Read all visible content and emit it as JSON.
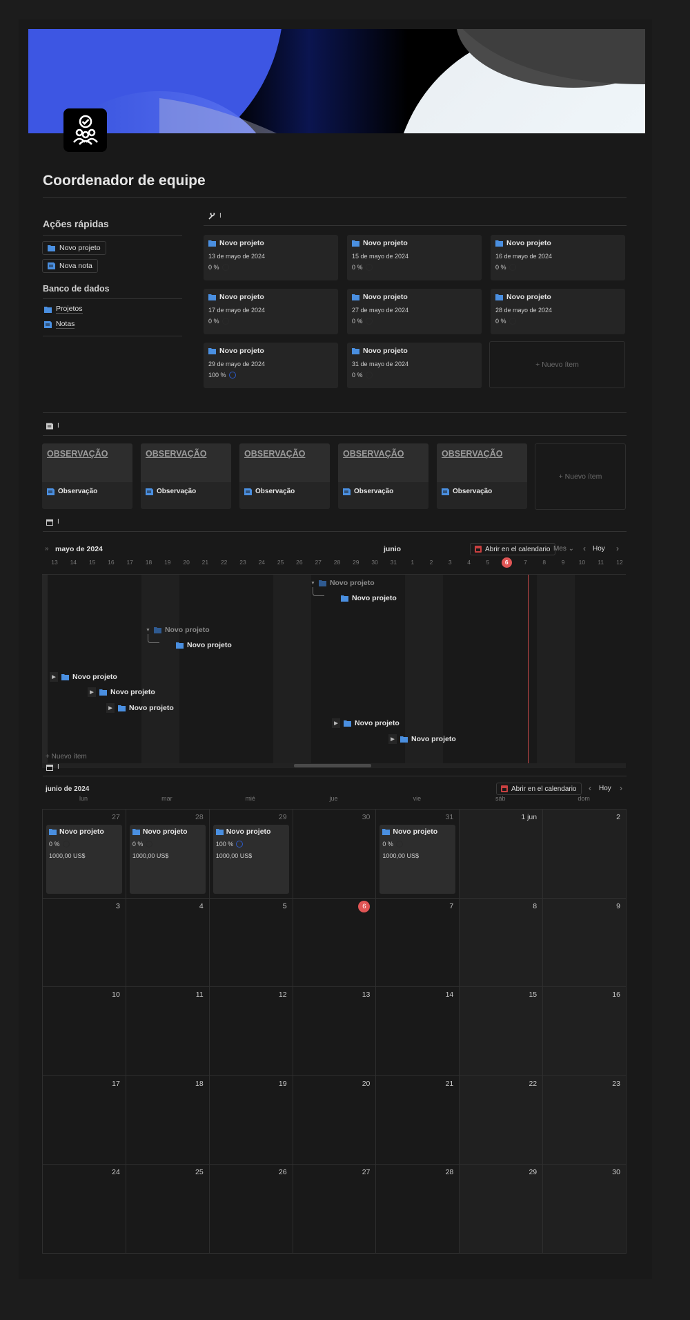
{
  "page": {
    "title": "Coordenador de equipe",
    "colors": {
      "accent_blue": "#3a5ce6",
      "folder_blue": "#4a8fe0",
      "today_red": "#e05555"
    }
  },
  "quick_actions": {
    "heading": "Ações rápidas",
    "buttons": [
      "Novo projeto",
      "Nova nota"
    ]
  },
  "databases": {
    "heading": "Banco de dados",
    "links": [
      "Projetos",
      "Notas"
    ]
  },
  "projects_gallery": {
    "header_label": "I",
    "cards": [
      {
        "name": "Novo projeto",
        "date": "13 de mayo de 2024",
        "progress": "0 %"
      },
      {
        "name": "Novo projeto",
        "date": "15 de mayo de 2024",
        "progress": "0 %"
      },
      {
        "name": "Novo projeto",
        "date": "16 de mayo de 2024",
        "progress": "0 %"
      },
      {
        "name": "Novo projeto",
        "date": "17 de mayo de 2024",
        "progress": "0 %"
      },
      {
        "name": "Novo projeto",
        "date": "27 de mayo de 2024",
        "progress": "0 %"
      },
      {
        "name": "Novo projeto",
        "date": "28 de mayo de 2024",
        "progress": "0 %"
      },
      {
        "name": "Novo projeto",
        "date": "29 de mayo de 2024",
        "progress": "100 %"
      },
      {
        "name": "Novo projeto",
        "date": "31 de mayo de 2024",
        "progress": "0 %"
      }
    ],
    "new_item": "+ Nuevo ítem"
  },
  "notes_gallery": {
    "header_label": "I",
    "cards": [
      {
        "title": "OBSERVAÇÃO",
        "name": "Observação"
      },
      {
        "title": "OBSERVAÇÃO",
        "name": "Observação"
      },
      {
        "title": "OBSERVAÇÃO",
        "name": "Observação"
      },
      {
        "title": "OBSERVAÇÃO",
        "name": "Observação"
      },
      {
        "title": "OBSERVAÇÃO",
        "name": "Observação"
      }
    ],
    "new_item": "+ Nuevo ítem"
  },
  "timeline": {
    "header_label": "I",
    "month_left": "mayo de 2024",
    "month_right": "junio",
    "open_calendar": "Abrir en el calendario",
    "scale": "Mes",
    "today_btn": "Hoy",
    "days": [
      "13",
      "14",
      "15",
      "16",
      "17",
      "18",
      "19",
      "20",
      "21",
      "22",
      "23",
      "24",
      "25",
      "26",
      "27",
      "28",
      "29",
      "30",
      "31",
      "1",
      "2",
      "3",
      "4",
      "5",
      "6",
      "7",
      "8",
      "9",
      "10",
      "11",
      "12"
    ],
    "today_day": "6",
    "new_item": "+ Nuevo ítem",
    "bars": [
      {
        "name": "Novo projeto",
        "parent": true
      },
      {
        "name": "Novo projeto"
      },
      {
        "name": "Novo projeto",
        "parent": true
      },
      {
        "name": "Novo projeto"
      },
      {
        "name": "Novo projeto"
      },
      {
        "name": "Novo projeto"
      },
      {
        "name": "Novo projeto"
      },
      {
        "name": "Novo projeto"
      },
      {
        "name": "Novo projeto"
      }
    ]
  },
  "calendar": {
    "header_label": "I",
    "month": "junio de 2024",
    "open_calendar": "Abrir en el calendario",
    "today_btn": "Hoy",
    "weekdays": [
      "lun",
      "mar",
      "mié",
      "jue",
      "vie",
      "sáb",
      "dom"
    ],
    "weeks": [
      [
        "27",
        "28",
        "29",
        "30",
        "31",
        "1 jun",
        "2"
      ],
      [
        "3",
        "4",
        "5",
        "6",
        "7",
        "8",
        "9"
      ],
      [
        "10",
        "11",
        "12",
        "13",
        "14",
        "15",
        "16"
      ],
      [
        "17",
        "18",
        "19",
        "20",
        "21",
        "22",
        "23"
      ],
      [
        "24",
        "25",
        "26",
        "27",
        "28",
        "29",
        "30"
      ]
    ],
    "events": [
      {
        "name": "Novo projeto",
        "progress": "0 %",
        "price": "1000,00 US$"
      },
      {
        "name": "Novo projeto",
        "progress": "0 %",
        "price": "1000,00 US$"
      },
      {
        "name": "Novo projeto",
        "progress": "100 %",
        "price": "1000,00 US$"
      },
      {
        "name": "Novo projeto",
        "progress": "0 %",
        "price": "1000,00 US$"
      }
    ]
  }
}
